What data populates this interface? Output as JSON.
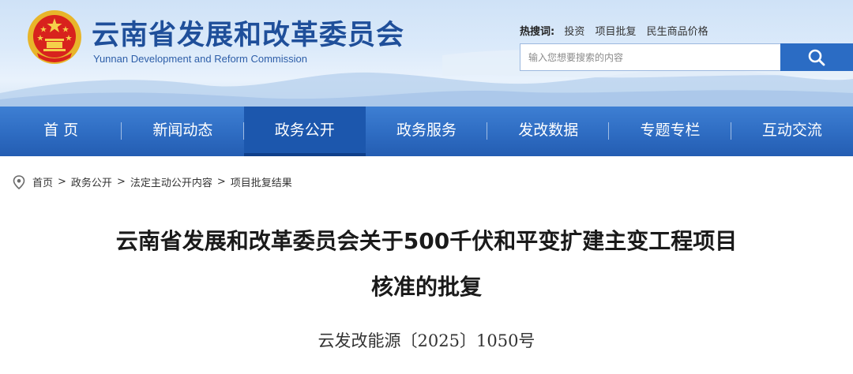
{
  "header": {
    "title": "云南省发展和改革委员会",
    "subtitle": "Yunnan Development and Reform Commission",
    "emblem": "national-emblem"
  },
  "hot_search": {
    "label": "热搜词:",
    "items": [
      "投资",
      "项目批复",
      "民生商品价格"
    ]
  },
  "search": {
    "placeholder": "输入您想要搜索的内容",
    "button_icon": "search-icon"
  },
  "nav": {
    "items": [
      {
        "label": "首 页"
      },
      {
        "label": "新闻动态"
      },
      {
        "label": "政务公开",
        "active": true
      },
      {
        "label": "政务服务"
      },
      {
        "label": "发改数据"
      },
      {
        "label": "专题专栏"
      },
      {
        "label": "互动交流"
      }
    ]
  },
  "breadcrumb": {
    "icon": "location-pin-icon",
    "items": [
      "首页",
      "政务公开",
      "法定主动公开内容",
      "项目批复结果"
    ],
    "separator": ">"
  },
  "article": {
    "title_line1": "云南省发展和改革委员会关于500千伏和平变扩建主变工程项目",
    "title_line2": "核准的批复",
    "doc_number": "云发改能源〔2025〕1050号"
  },
  "colors": {
    "brand_blue": "#2b6cc4",
    "nav_blue": "#2e6cc2",
    "title_blue": "#1f4f9a"
  }
}
